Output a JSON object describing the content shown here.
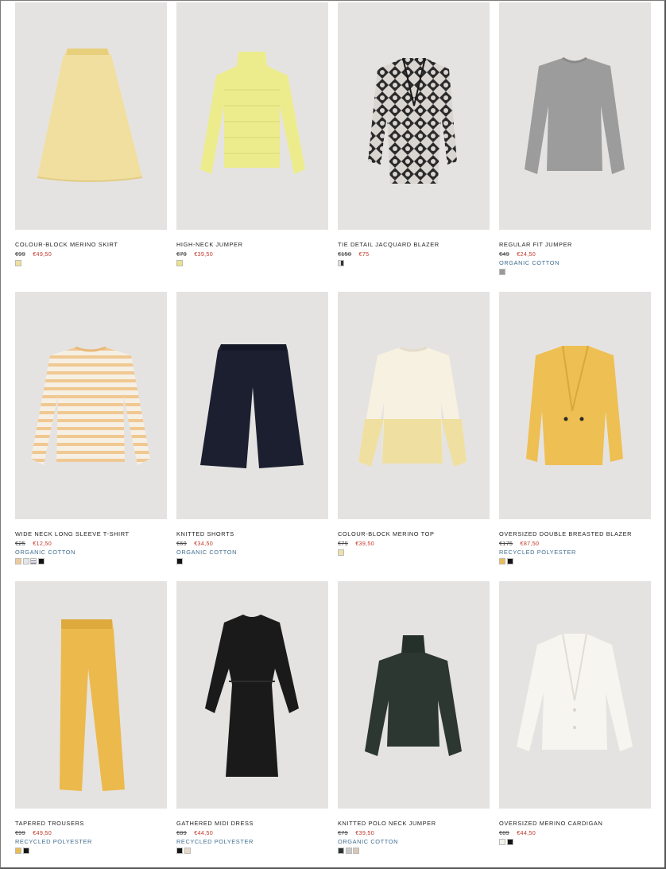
{
  "products": [
    {
      "name": "COLOUR-BLOCK MERINO SKIRT",
      "old_price": "€99",
      "sale_price": "€49,50",
      "tag": "",
      "swatches": [
        "#efdf9f"
      ],
      "icon": "skirt-icon"
    },
    {
      "name": "HIGH-NECK JUMPER",
      "old_price": "€79",
      "sale_price": "€39,50",
      "tag": "",
      "swatches": [
        "#efe08a"
      ],
      "icon": "jumper-icon"
    },
    {
      "name": "TIE DETAIL JACQUARD BLAZER",
      "old_price": "€150",
      "sale_price": "€75",
      "tag": "",
      "swatches": [
        "#3a3a3a"
      ],
      "icon": "blazer-icon"
    },
    {
      "name": "REGULAR FIT JUMPER",
      "old_price": "€49",
      "sale_price": "€24,50",
      "tag": "ORGANIC COTTON",
      "swatches": [
        "#9a9a9a"
      ],
      "icon": "jumper-icon"
    },
    {
      "name": "WIDE NECK LONG SLEEVE T-SHIRT",
      "old_price": "€25",
      "sale_price": "€12,50",
      "tag": "ORGANIC COTTON",
      "swatches": [
        "#f1c89a",
        "#e6e6e6",
        "#8a8f9c",
        "#111111"
      ],
      "icon": "striped-tshirt-icon"
    },
    {
      "name": "KNITTED SHORTS",
      "old_price": "€69",
      "sale_price": "€34,50",
      "tag": "ORGANIC COTTON",
      "swatches": [
        "#151515"
      ],
      "icon": "shorts-icon"
    },
    {
      "name": "COLOUR-BLOCK MERINO TOP",
      "old_price": "€79",
      "sale_price": "€39,50",
      "tag": "",
      "swatches": [
        "#efe0a8"
      ],
      "icon": "top-icon"
    },
    {
      "name": "OVERSIZED DOUBLE BREASTED BLAZER",
      "old_price": "€175",
      "sale_price": "€87,50",
      "tag": "RECYCLED POLYESTER",
      "swatches": [
        "#e9bd52",
        "#151515"
      ],
      "icon": "blazer-icon"
    },
    {
      "name": "TAPERED TROUSERS",
      "old_price": "€99",
      "sale_price": "€49,50",
      "tag": "RECYCLED POLYESTER",
      "swatches": [
        "#e9bd52",
        "#151515"
      ],
      "icon": "trousers-icon"
    },
    {
      "name": "GATHERED MIDI DRESS",
      "old_price": "€89",
      "sale_price": "€44,50",
      "tag": "RECYCLED POLYESTER",
      "swatches": [
        "#151515",
        "#e8d8c8"
      ],
      "icon": "dress-icon"
    },
    {
      "name": "KNITTED POLO NECK JUMPER",
      "old_price": "€79",
      "sale_price": "€39,50",
      "tag": "ORGANIC COTTON",
      "swatches": [
        "#2c3530",
        "#c8c8c8",
        "#d9c8b8"
      ],
      "icon": "polo-neck-icon"
    },
    {
      "name": "OVERSIZED MERINO CARDIGAN",
      "old_price": "€89",
      "sale_price": "€44,50",
      "tag": "",
      "swatches": [
        "#f4f1ea",
        "#151515"
      ],
      "icon": "cardigan-icon"
    }
  ],
  "colors": {
    "sale_price": "#c0392b",
    "tag": "#3f6c8f",
    "thumb_bg": "#e5e3e1"
  }
}
